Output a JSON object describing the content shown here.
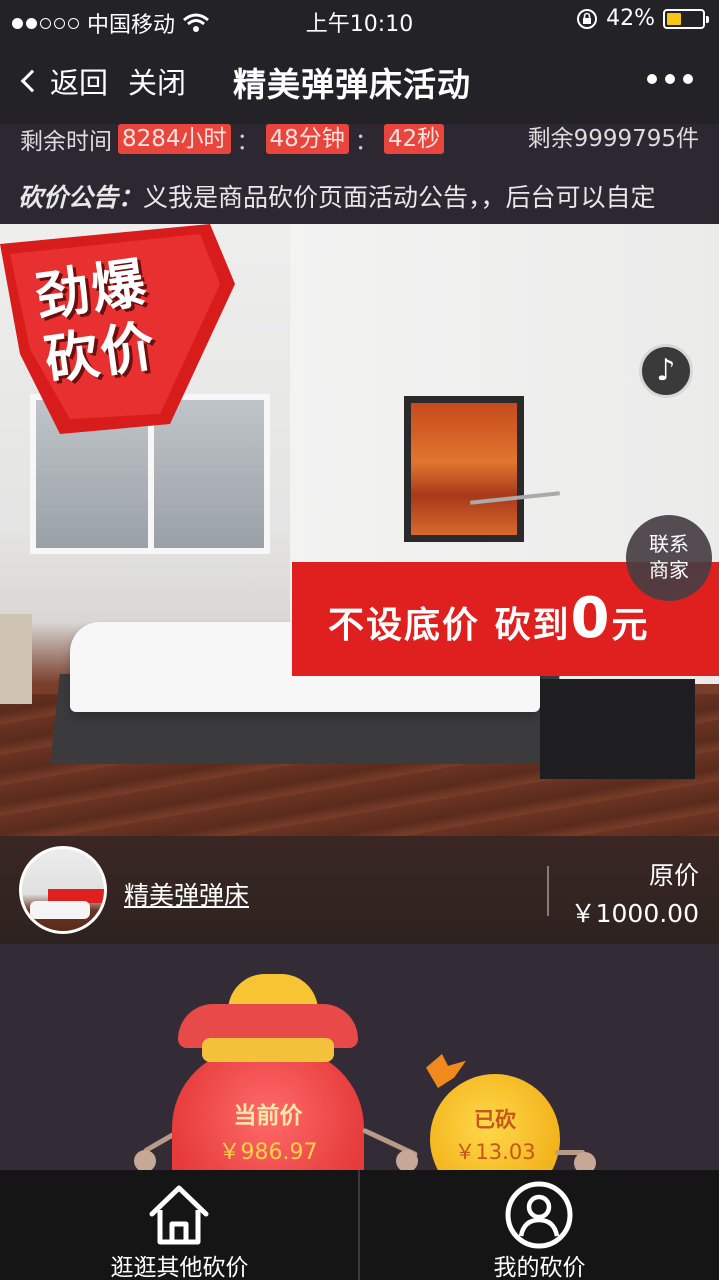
{
  "status_bar": {
    "carrier": "中国移动",
    "time": "上午10:10",
    "battery_percent": "42%",
    "battery_level": 0.42,
    "signal_bars_filled": 2,
    "signal_bars_total": 5
  },
  "nav": {
    "back_label": "返回",
    "close_label": "关闭",
    "title": "精美弹弹床活动"
  },
  "countdown": {
    "label": "剩余时间",
    "hours": "8284小时",
    "minutes": "48分钟",
    "seconds": "42秒",
    "separator": "：",
    "stock": "剩余9999795件"
  },
  "notice": {
    "label": "砍价公告：",
    "text": "义我是商品砍价页面活动公告，，后台可以自定"
  },
  "hero": {
    "promo_line1": "劲爆",
    "promo_line2": "砍价",
    "banner_text": "不设底价 砍到",
    "banner_big": "0",
    "banner_unit": "元",
    "music_icon": "♪",
    "contact_line1": "联系",
    "contact_line2": "商家"
  },
  "product": {
    "name": "精美弹弹床",
    "original_price_label": "原价",
    "original_price": "￥1000.00"
  },
  "bargain": {
    "current_label": "当前价",
    "current_value": "￥986.97",
    "cut_label": "已砍",
    "cut_value": "￥13.03"
  },
  "tabs": [
    {
      "label": "逛逛其他砍价",
      "icon": "home-icon"
    },
    {
      "label": "我的砍价",
      "icon": "user-icon"
    }
  ],
  "colors": {
    "accent_red": "#e01f1f",
    "countdown_red": "#e8453c",
    "battery_yellow": "#f5c518",
    "gold": "#f4c23a"
  }
}
